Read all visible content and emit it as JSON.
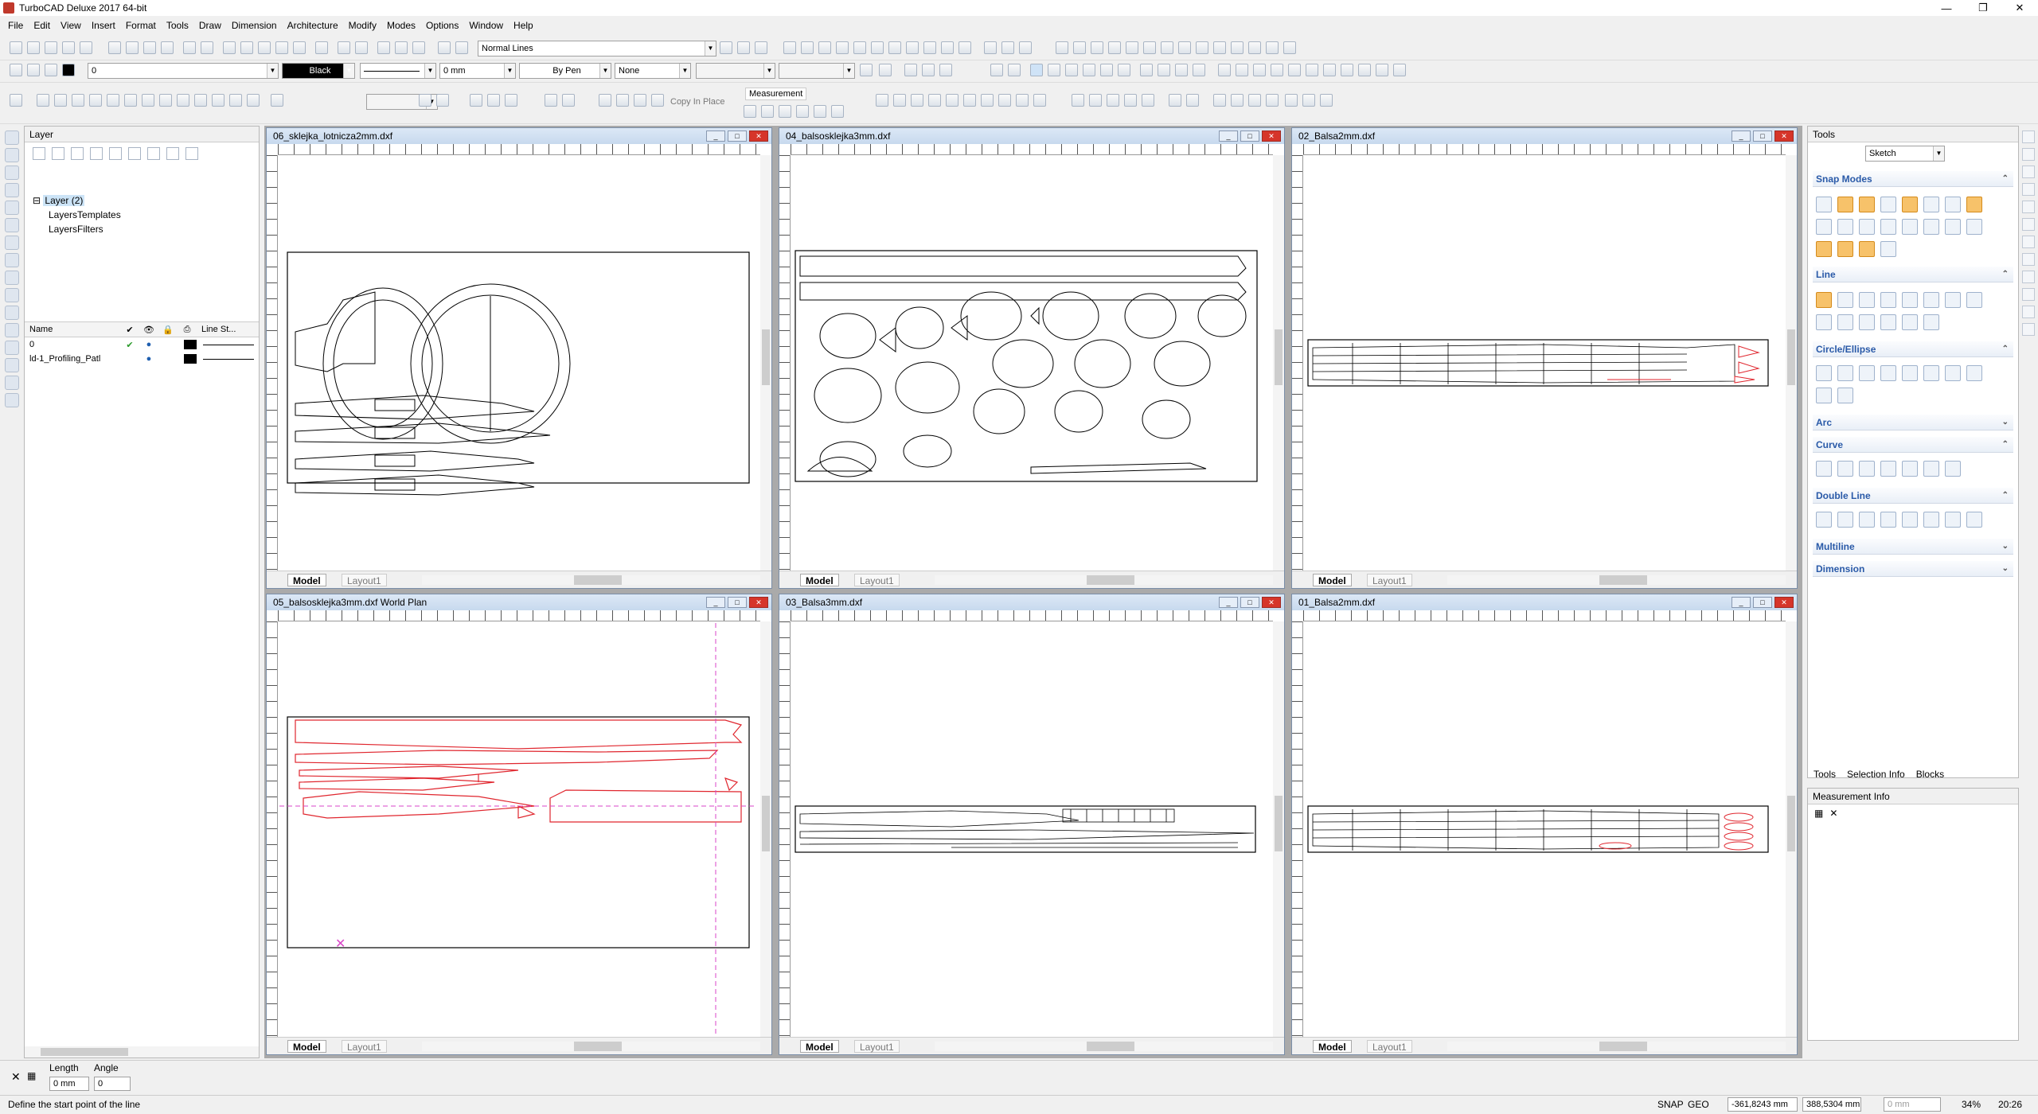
{
  "window": {
    "title": "TurboCAD Deluxe 2017 64-bit",
    "controls": [
      "—",
      "❐",
      "✕"
    ]
  },
  "menu": [
    "File",
    "Edit",
    "View",
    "Insert",
    "Format",
    "Tools",
    "Draw",
    "Dimension",
    "Architecture",
    "Modify",
    "Modes",
    "Options",
    "Window",
    "Help"
  ],
  "toolbar": {
    "line_style": "Normal Lines",
    "layer_value": "0",
    "color_value": "Black",
    "width_value": "0 mm",
    "pen_value": "By Pen",
    "fill_value": "None",
    "copy_in_place": "Copy In Place",
    "measurement_label": "Measurement"
  },
  "layer_panel": {
    "title": "Layer",
    "tree": [
      "Layer (2)",
      "LayersTemplates",
      "LayersFilters"
    ],
    "headers": [
      "Name",
      "",
      "",
      "",
      "",
      "Line St..."
    ],
    "rows": [
      {
        "name": "0"
      },
      {
        "name": "ld-1_Profiling_Patl"
      }
    ]
  },
  "viewports": [
    {
      "title": "06_sklejka_lotnicza2mm.dxf",
      "model_tab": "Model",
      "layout_tab": "Layout1"
    },
    {
      "title": "04_balsosklejka3mm.dxf",
      "model_tab": "Model",
      "layout_tab": "Layout1"
    },
    {
      "title": "02_Balsa2mm.dxf",
      "model_tab": "Model",
      "layout_tab": "Layout1"
    },
    {
      "title": "05_balsosklejka3mm.dxf World Plan",
      "model_tab": "Model",
      "layout_tab": "Layout1"
    },
    {
      "title": "03_Balsa3mm.dxf",
      "model_tab": "Model",
      "layout_tab": "Layout1"
    },
    {
      "title": "01_Balsa2mm.dxf",
      "model_tab": "Model",
      "layout_tab": "Layout1"
    }
  ],
  "tools_panel": {
    "title": "Tools",
    "mode": "Sketch",
    "sections": [
      {
        "label": "Snap Modes",
        "state": "open"
      },
      {
        "label": "Line",
        "state": "open"
      },
      {
        "label": "Circle/Ellipse",
        "state": "open"
      },
      {
        "label": "Arc",
        "state": "closed"
      },
      {
        "label": "Curve",
        "state": "open"
      },
      {
        "label": "Double Line",
        "state": "open"
      },
      {
        "label": "Multiline",
        "state": "closed"
      },
      {
        "label": "Dimension",
        "state": "closed"
      }
    ],
    "tabs": [
      "Tools",
      "Selection Info",
      "Blocks"
    ]
  },
  "measurement_panel": {
    "title": "Measurement Info"
  },
  "inspector": {
    "length_label": "Length",
    "length_value": "0 mm",
    "angle_label": "Angle",
    "angle_value": "0"
  },
  "status": {
    "message": "Define the start point of the line",
    "snap": "SNAP",
    "geo": "GEO",
    "x": "-361,8243 mm",
    "y": "388,5304 mm",
    "z_placeholder": "0 mm",
    "zoom": "34%",
    "time": "20:26"
  },
  "colors": {
    "accent": "#f7c26a",
    "drawing_red": "#e0262e",
    "magenta_guide": "#d946c8",
    "title_blue": "#c7d9ee"
  }
}
